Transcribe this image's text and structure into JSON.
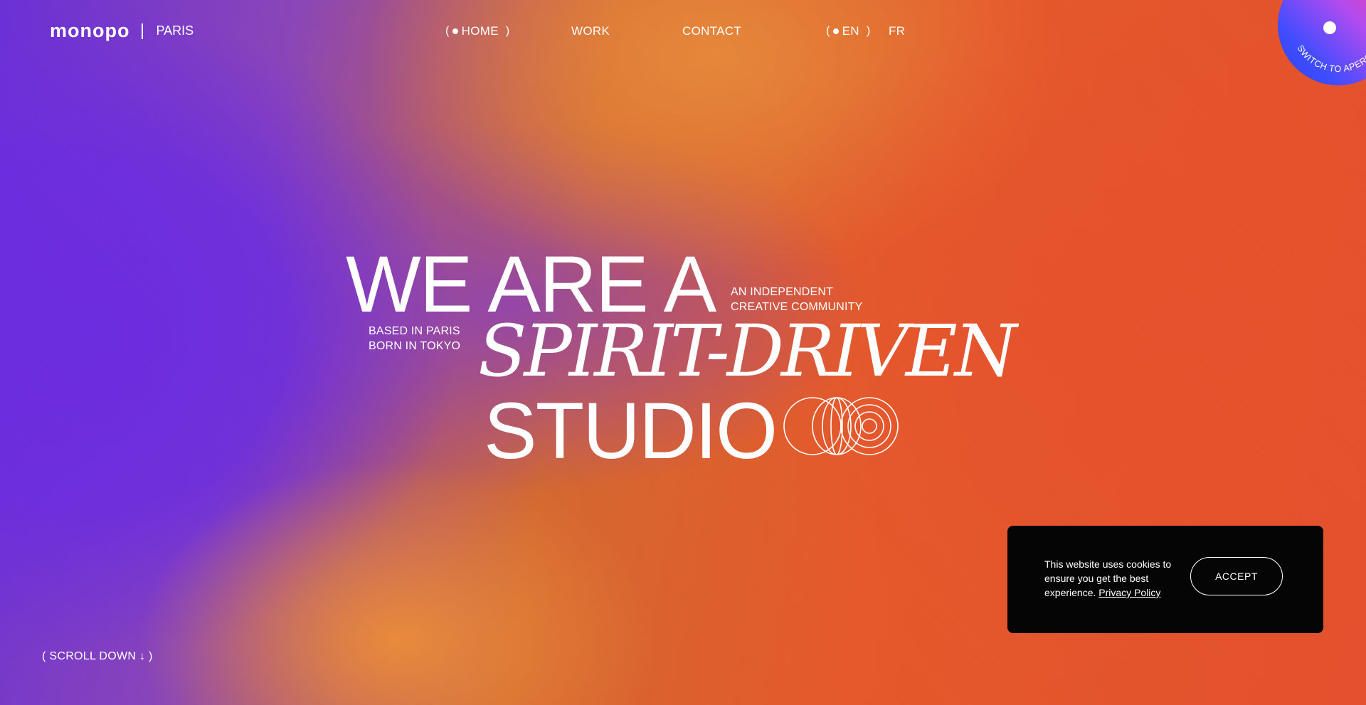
{
  "header": {
    "logo": "monopo",
    "city": "PARIS",
    "nav": [
      "HOME",
      "WORK",
      "CONTACT"
    ],
    "paren_open": "(",
    "paren_close": ")",
    "languages": [
      "EN",
      "FR"
    ]
  },
  "apero_badge": {
    "label": "SWITCH TO APERO MODE"
  },
  "hero": {
    "line1": "WE ARE A",
    "line2": "SPIRIT-DRIVEN",
    "line3": "STUDIO",
    "side_right": [
      "AN INDEPENDENT",
      "CREATIVE COMMUNITY"
    ],
    "side_left": [
      "BASED IN PARIS",
      "BORN IN TOKYO"
    ]
  },
  "cookie": {
    "message": "This website uses cookies to ensure you get the best experience.",
    "link": "Privacy Policy",
    "accept": "ACCEPT"
  },
  "scroll_hint": "( SCROLL DOWN ↓ )",
  "colors": {
    "purple": "#6a2fd6",
    "orange": "#e6582a",
    "badge_blue": "#2f45ee",
    "badge_pink": "#ff3c8f",
    "cookie_bg": "#050505"
  }
}
